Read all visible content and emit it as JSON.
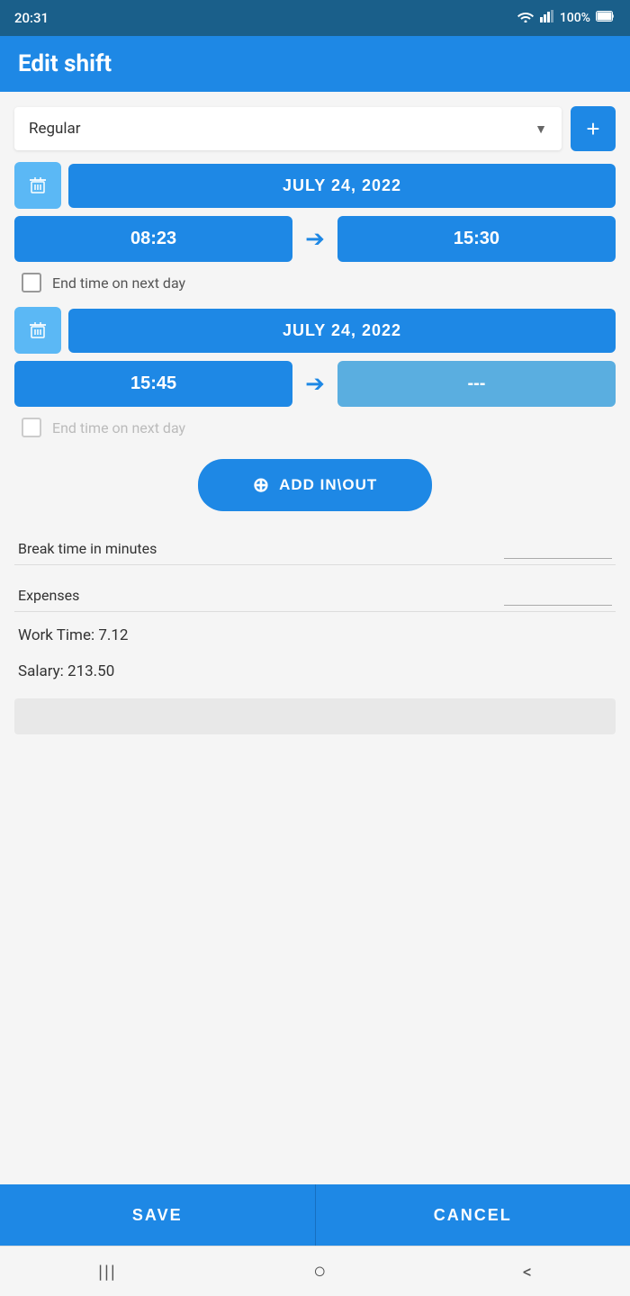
{
  "statusBar": {
    "time": "20:31",
    "battery": "100%",
    "signal": "WiFi"
  },
  "header": {
    "title": "Edit shift"
  },
  "shiftType": {
    "value": "Regular",
    "addButtonLabel": "+"
  },
  "entry1": {
    "date": "JULY 24, 2022",
    "startTime": "08:23",
    "endTime": "15:30",
    "endTimeNextDay": "End time on next day",
    "endTimeNextDayChecked": false
  },
  "entry2": {
    "date": "JULY 24, 2022",
    "startTime": "15:45",
    "endTime": "---",
    "endTimeNextDay": "End time on next day",
    "endTimeNextDayChecked": false,
    "disabled": true
  },
  "addInOut": {
    "label": "ADD IN\\OUT"
  },
  "breakTime": {
    "label": "Break time in minutes",
    "value": ""
  },
  "expenses": {
    "label": "Expenses",
    "value": ""
  },
  "workTime": {
    "label": "Work Time:",
    "value": "7.12"
  },
  "salary": {
    "label": "Salary:",
    "value": "213.50"
  },
  "buttons": {
    "save": "SAVE",
    "cancel": "CANCEL"
  },
  "nav": {
    "menuIcon": "|||",
    "homeIcon": "○",
    "backIcon": "<"
  }
}
